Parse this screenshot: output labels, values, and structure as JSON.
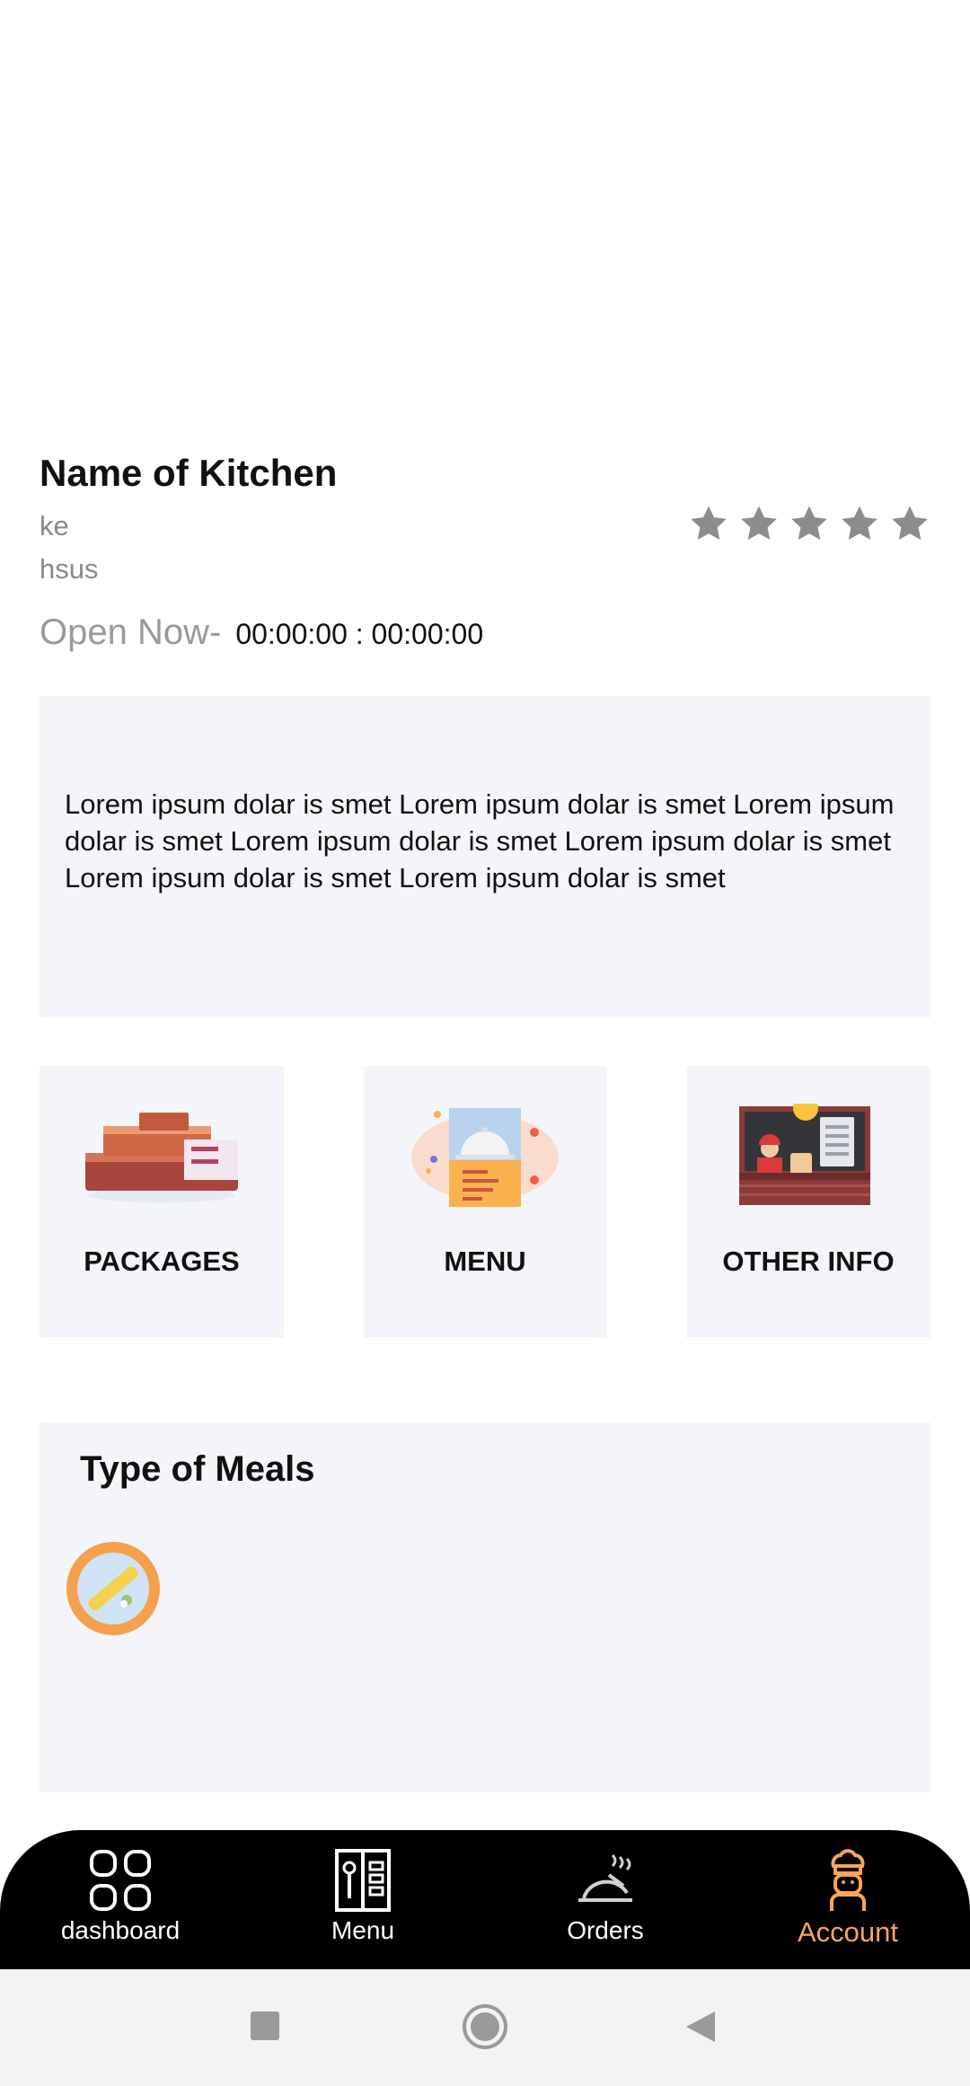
{
  "kitchen": {
    "name": "Name of Kitchen",
    "sub1": "ke",
    "sub2": "hsus",
    "rating_stars": 5,
    "open_label": "Open Now-",
    "open_time": "00:00:00 : 00:00:00"
  },
  "description": "Lorem ipsum dolar is smet Lorem ipsum dolar is smet  Lorem ipsum dolar is smet  Lorem ipsum dolar is smet  Lorem ipsum dolar is smet  Lorem ipsum dolar is smet  Lorem ipsum dolar is smet",
  "cards": {
    "packages": "PACKAGES",
    "menu": "MENU",
    "other_info": "OTHER INFO"
  },
  "meals": {
    "title": "Type of Meals"
  },
  "nav": {
    "dashboard": "dashboard",
    "menu": "Menu",
    "orders": "Orders",
    "account": "Account",
    "active": "account",
    "active_color": "#f7a55a"
  },
  "colors": {
    "panel_bg": "#f3f5f9",
    "star": "#8c8c8c",
    "nav_bg": "#000000"
  }
}
